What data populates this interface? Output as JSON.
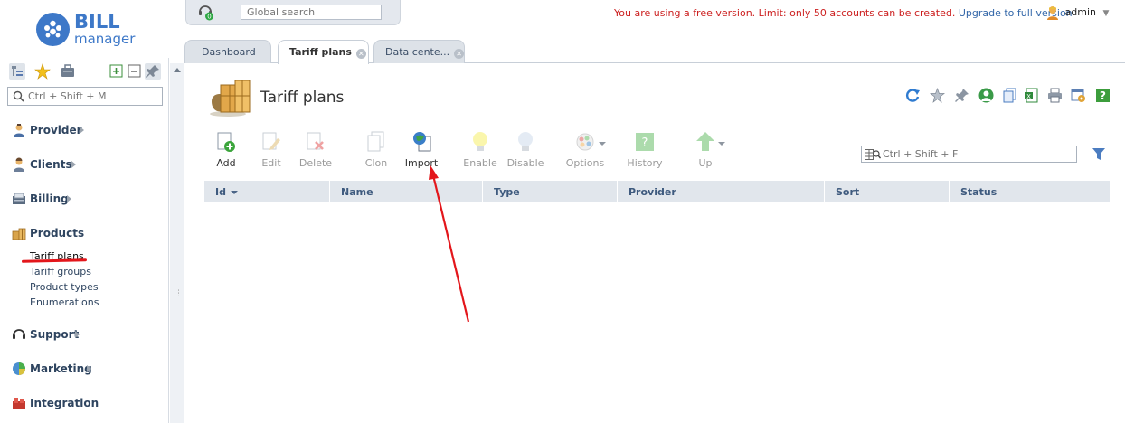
{
  "app": {
    "logo_word": "BILL",
    "logo_sub": "manager"
  },
  "top": {
    "search_placeholder": "Global search",
    "support_badge": "0",
    "notice_text": "You are using a free version. Limit: only 50 accounts can be created.",
    "upgrade_link": "Upgrade to full version",
    "user": "admin"
  },
  "tabs": [
    {
      "label": "Dashboard",
      "active": false,
      "closable": false
    },
    {
      "label": "Tariff plans",
      "active": true,
      "closable": true
    },
    {
      "label": "Data cente...",
      "active": false,
      "closable": true
    }
  ],
  "sidebar": {
    "search_placeholder": "Ctrl + Shift + M",
    "tool_icons": [
      "tree-view-icon",
      "star-icon",
      "briefcase-icon",
      "expand-all-icon",
      "collapse-all-icon",
      "pin-icon"
    ],
    "groups": [
      {
        "label": "Provider",
        "icon": "provider-icon"
      },
      {
        "label": "Clients",
        "icon": "clients-icon"
      },
      {
        "label": "Billing",
        "icon": "billing-icon"
      },
      {
        "label": "Products",
        "icon": "products-icon"
      },
      {
        "label": "Support",
        "icon": "support-icon"
      },
      {
        "label": "Marketing",
        "icon": "marketing-icon"
      },
      {
        "label": "Integration",
        "icon": "integration-icon"
      }
    ],
    "products_items": [
      "Tariff plans",
      "Tariff groups",
      "Product types",
      "Enumerations"
    ],
    "current_item": "Tariff plans"
  },
  "page": {
    "title": "Tariff plans",
    "header_tools": [
      "refresh-icon",
      "star-icon",
      "pin-icon",
      "user-icon",
      "copy-icon",
      "excel-icon",
      "print-icon",
      "settings-icon",
      "help-icon"
    ]
  },
  "toolbar": [
    {
      "label": "Add",
      "icon": "add-icon",
      "enabled": true
    },
    {
      "label": "Edit",
      "icon": "edit-icon",
      "enabled": false
    },
    {
      "label": "Delete",
      "icon": "delete-icon",
      "enabled": false
    },
    {
      "label": "Clon",
      "icon": "clone-icon",
      "enabled": false
    },
    {
      "label": "Import",
      "icon": "import-icon",
      "enabled": true
    },
    {
      "label": "Enable",
      "icon": "bulb-on-icon",
      "enabled": false
    },
    {
      "label": "Disable",
      "icon": "bulb-off-icon",
      "enabled": false
    },
    {
      "label": "Options",
      "icon": "options-icon",
      "enabled": false
    },
    {
      "label": "History",
      "icon": "history-icon",
      "enabled": false
    },
    {
      "label": "Up",
      "icon": "up-arrow-icon",
      "enabled": false
    }
  ],
  "table": {
    "search_placeholder": "Ctrl + Shift + F",
    "columns": [
      "Id",
      "Name",
      "Type",
      "Provider",
      "Sort",
      "Status"
    ],
    "sorted_by": "Id",
    "rows": []
  },
  "colors": {
    "accent": "#3d78c8",
    "notice": "#cc1f1f",
    "link": "#3266a8",
    "header_bg": "#e1e6ec",
    "annotation": "#e3161b"
  }
}
